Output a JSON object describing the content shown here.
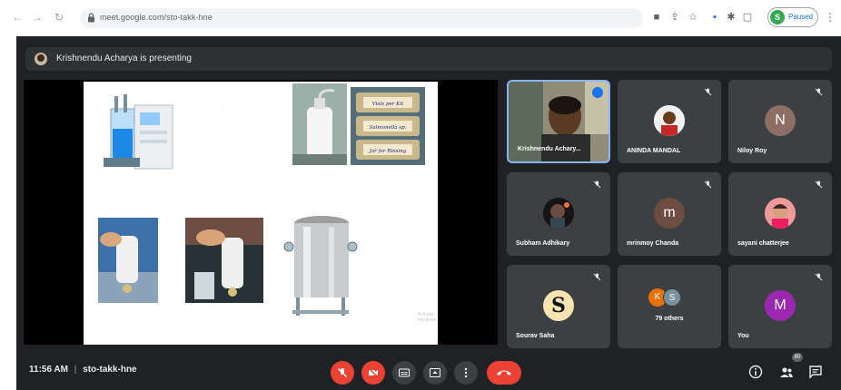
{
  "browser": {
    "url": "meet.google.com/sto-takk-hne",
    "profile_initial": "S",
    "profile_label": "Paused"
  },
  "meet": {
    "presenting_banner": "Krishnendu Acharya is presenting",
    "meeting_time": "11:56 AM",
    "separator": "|",
    "meeting_code": "sto-takk-hne",
    "participant_count_badge": "80"
  },
  "slide": {
    "jar_labels": [
      "Vials per Kit",
      "Salmonella sp.",
      "Jar for Rinsing"
    ],
    "watermark": "Activate Windows"
  },
  "tiles": [
    {
      "name": "Krishnendu Achary...",
      "kind": "video"
    },
    {
      "name": "ANINDA MANDAL",
      "kind": "photo"
    },
    {
      "name": "Niloy Roy",
      "kind": "letter",
      "letter": "N",
      "color": "#8d6e63"
    },
    {
      "name": "Subham Adhikary",
      "kind": "photo"
    },
    {
      "name": "mrinmoy Chanda",
      "kind": "letter",
      "letter": "m",
      "color": "#6d4c41"
    },
    {
      "name": "sayani chatterjee",
      "kind": "photo"
    },
    {
      "name": "Sourav Saha",
      "kind": "logo",
      "letter": "S"
    },
    {
      "name": "79 others",
      "kind": "group",
      "letters": [
        "K",
        "S"
      ],
      "colors": [
        "#e8710a",
        "#78909c"
      ]
    },
    {
      "name": "You",
      "kind": "letter",
      "letter": "M",
      "color": "#9c27b0"
    }
  ],
  "colors": {
    "meet_bg": "#202124",
    "tile_bg": "#3c4043",
    "danger": "#ea4335",
    "accent": "#1a73e8"
  }
}
